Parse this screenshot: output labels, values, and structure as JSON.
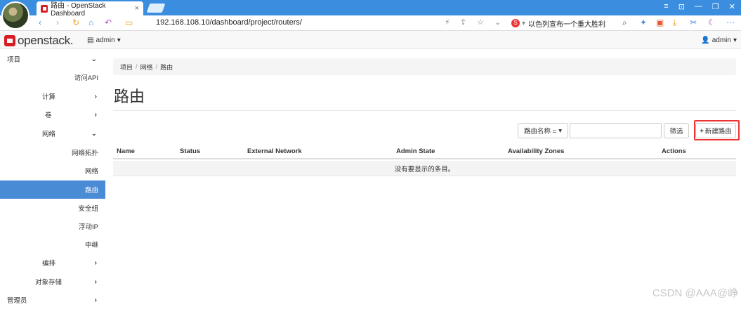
{
  "browser": {
    "tab_title": "路由 - OpenStack Dashboard",
    "tab_close": "×",
    "url": "192.168.108.10/dashboard/project/routers/",
    "search_text": "以色列宣布一个重大胜利",
    "window_controls": [
      "≡",
      "⊡",
      "—",
      "❐",
      "✕"
    ]
  },
  "header": {
    "logo_text": "openstack.",
    "project_label": "admin",
    "user_label": "admin"
  },
  "sidebar": {
    "items": [
      {
        "label": "项目",
        "chevron": "down",
        "active": false
      },
      {
        "label": "访问API",
        "chevron": "",
        "active": false
      },
      {
        "label": "计算",
        "chevron": "right",
        "active": false
      },
      {
        "label": "卷",
        "chevron": "right",
        "active": false
      },
      {
        "label": "网络",
        "chevron": "down",
        "active": false
      },
      {
        "label": "网络拓扑",
        "chevron": "",
        "active": false
      },
      {
        "label": "网络",
        "chevron": "",
        "active": false
      },
      {
        "label": "路由",
        "chevron": "",
        "active": true
      },
      {
        "label": "安全组",
        "chevron": "",
        "active": false
      },
      {
        "label": "浮动IP",
        "chevron": "",
        "active": false
      },
      {
        "label": "中继",
        "chevron": "",
        "active": false
      },
      {
        "label": "编排",
        "chevron": "right",
        "active": false
      },
      {
        "label": "对象存储",
        "chevron": "right",
        "active": false
      },
      {
        "label": "管理员",
        "chevron": "right",
        "active": false
      }
    ]
  },
  "breadcrumb": [
    "项目",
    "网络",
    "路由"
  ],
  "page_title": "路由",
  "filter": {
    "dropdown_label": "路由名称 =",
    "input_value": "",
    "filter_button": "筛选",
    "create_button": "新建路由"
  },
  "table": {
    "columns": [
      "Name",
      "Status",
      "External Network",
      "Admin State",
      "Availability Zones",
      "Actions"
    ],
    "empty_message": "没有要显示的条目。"
  },
  "watermark": "CSDN @AAA@峥",
  "colors": {
    "tab_bar": "#3b8de0",
    "active_nav": "#4a8bd6",
    "brand_red": "#d61d24",
    "highlight": "#ee3333"
  }
}
